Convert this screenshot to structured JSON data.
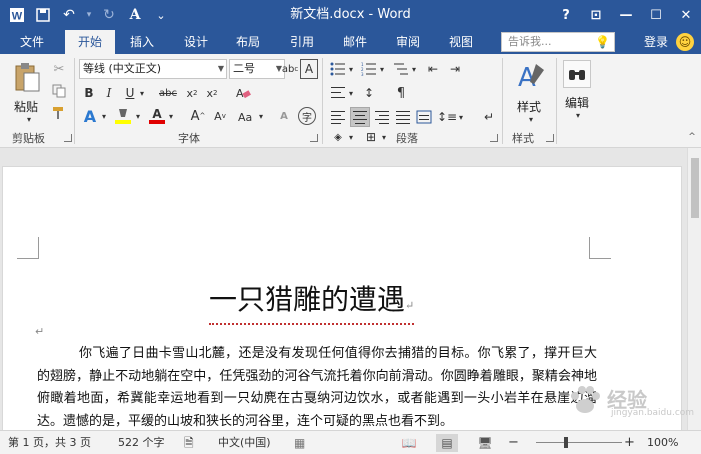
{
  "window": {
    "title": "新文档.docx - Word"
  },
  "qat": {
    "undo": "↶",
    "redo": "↻",
    "font_a": "A",
    "more": "⌄"
  },
  "window_controls": {
    "help": "?",
    "restore_ribbon": "⊡",
    "minimize": "—",
    "maximize": "☐",
    "close": "✕"
  },
  "tabs": [
    {
      "label": "文件",
      "active": false
    },
    {
      "label": "开始",
      "active": true
    },
    {
      "label": "插入",
      "active": false
    },
    {
      "label": "设计",
      "active": false
    },
    {
      "label": "布局",
      "active": false
    },
    {
      "label": "引用",
      "active": false
    },
    {
      "label": "邮件",
      "active": false
    },
    {
      "label": "审阅",
      "active": false
    },
    {
      "label": "视图",
      "active": false
    }
  ],
  "tellme": {
    "placeholder": "告诉我..."
  },
  "account": {
    "login": "登录"
  },
  "ribbon": {
    "clipboard": {
      "paste_label": "粘贴",
      "group_label": "剪贴板"
    },
    "font": {
      "font_name": "等线 (中文正文)",
      "font_size": "二号",
      "group_label": "字体"
    },
    "paragraph": {
      "group_label": "段落"
    },
    "styles": {
      "styles_label": "样式",
      "group_label": "样式"
    },
    "editing": {
      "editing_label": "编辑"
    }
  },
  "document": {
    "title": "一只猎雕的遭遇",
    "paragraph": "你飞遍了日曲卡雪山北麓，还是没有发现任何值得你去捕猎的目标。你飞累了，撑开巨大的翅膀，静止不动地躺在空中，任凭强劲的河谷气流托着你向前滑动。你圆睁着雕眼，聚精会神地俯瞰着地面，希冀能幸运地看到一只幼麂在古戛纳河边饮水，或者能遇到一头小岩羊在悬崖边溜达。遗憾的是，平缓的山坡和狭长的河谷里，连个可疑的黑点也看不到。"
  },
  "statusbar": {
    "page": "第 1 页，共 3 页",
    "words": "522 个字",
    "language": "中文(中国)",
    "zoom_minus": "−",
    "zoom_plus": "+",
    "zoom_level": "100%",
    "zoom_fraction": 0.35
  },
  "watermark": {
    "text": "经验",
    "sub": "jingyan.baidu.com"
  },
  "colors": {
    "accent": "#2b579a",
    "highlight": "#ffff00",
    "font_color": "#e00000"
  }
}
